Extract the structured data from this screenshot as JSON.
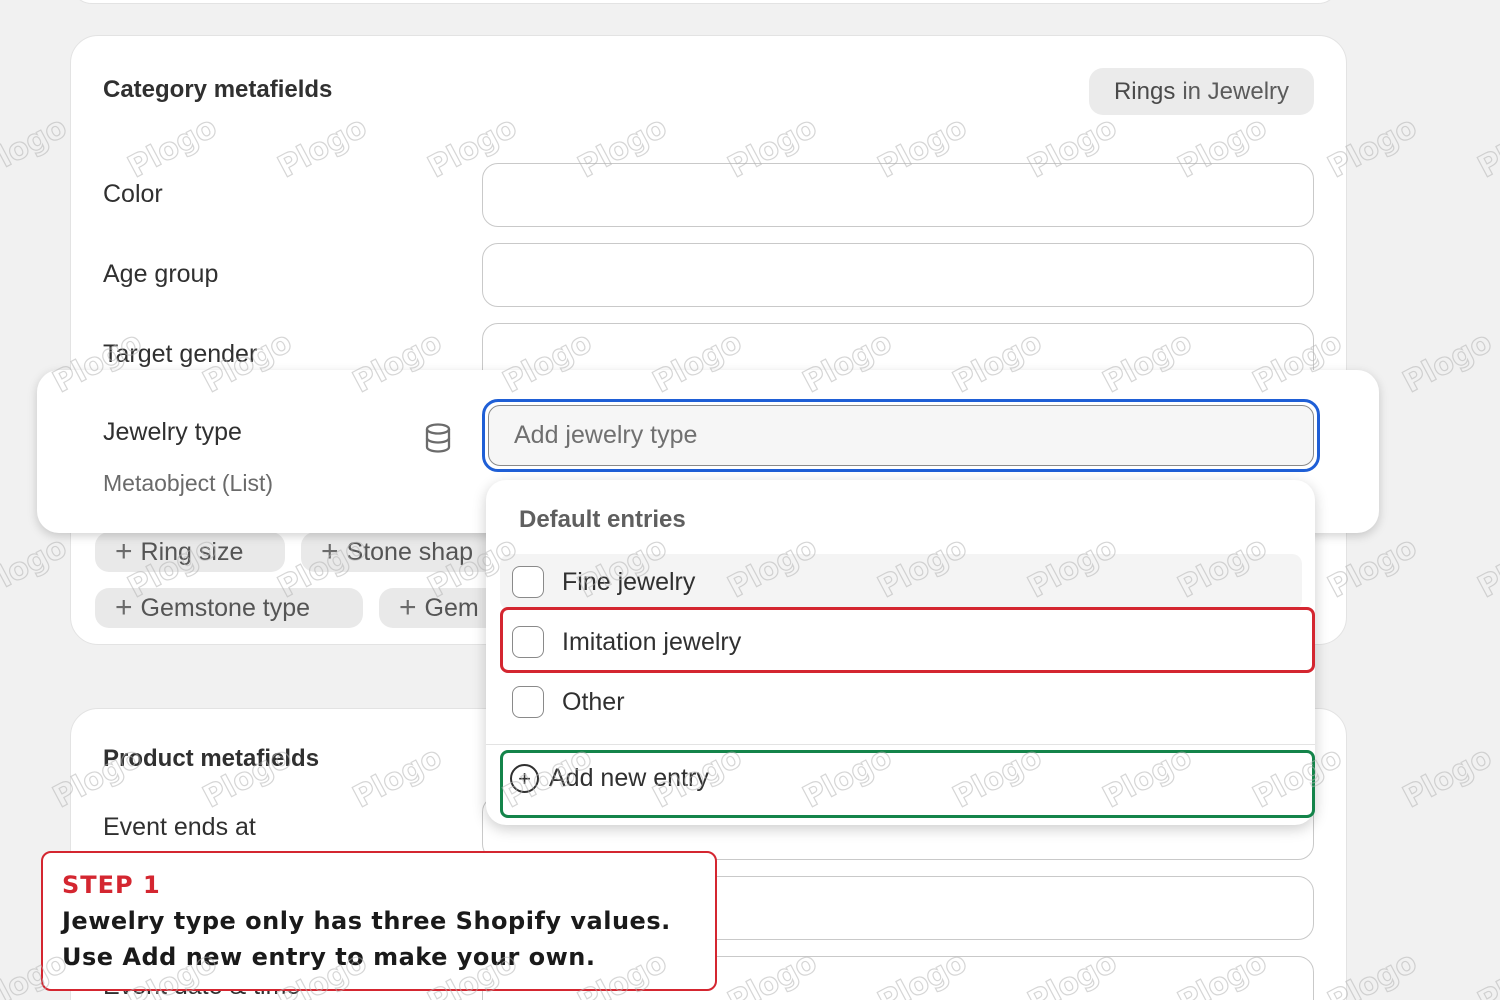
{
  "category_section": {
    "title": "Category metafields",
    "badge_strong": "Rings",
    "badge_rest": "in Jewelry",
    "fields": [
      "Color",
      "Age group",
      "Target gender"
    ]
  },
  "jewelry_type": {
    "label": "Jewelry type",
    "sublabel": "Metaobject (List)",
    "icon": "database-icon",
    "placeholder": "Add jewelry type"
  },
  "chips": {
    "ring_size": "Ring size",
    "stone_shape": "Stone shap",
    "gemstone_type": "Gemstone type",
    "gem": "Gem"
  },
  "dropdown": {
    "heading": "Default entries",
    "options": [
      "Fine jewelry",
      "Imitation jewelry",
      "Other"
    ],
    "add_label": "Add new entry"
  },
  "product_section": {
    "title": "Product metafields",
    "fields": [
      "Event ends at",
      "Event date & time"
    ]
  },
  "callout": {
    "step": "STEP 1",
    "line1": "Jewelry type only has three Shopify values.",
    "line2": "Use Add new entry to make your own."
  },
  "watermark": "Plogo",
  "colors": {
    "focus_blue": "#1f5fd6",
    "highlight_red": "#d42630",
    "highlight_green": "#14844a"
  }
}
